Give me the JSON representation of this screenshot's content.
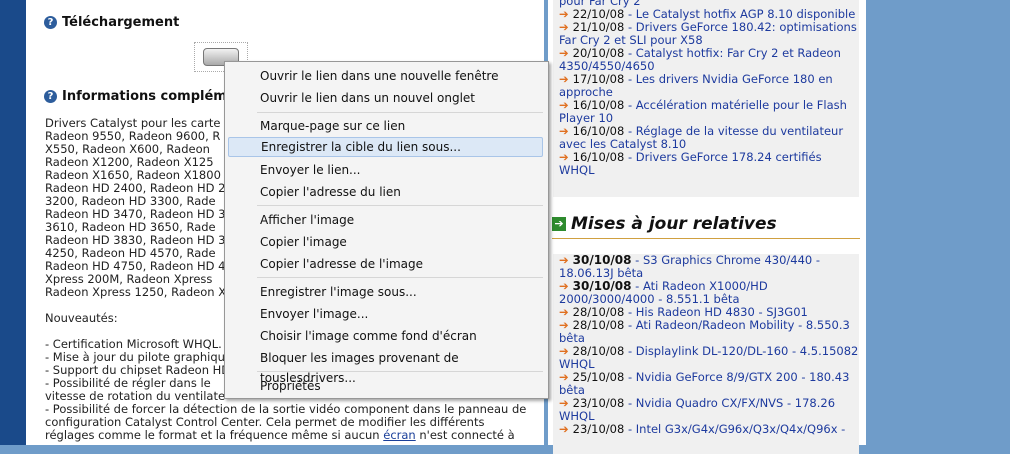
{
  "main": {
    "sections": [
      {
        "title": "Téléchargement"
      },
      {
        "title": "Informations compléme"
      }
    ],
    "text_lines": [
      "Drivers Catalyst pour les carte",
      "Radeon 9550, Radeon 9600, R",
      "X550, Radeon X600, Radeon",
      "Radeon X1200, Radeon X125",
      "Radeon X1650, Radeon X1800",
      "Radeon HD 2400, Radeon HD 2",
      "3200, Radeon HD 3300, Rade",
      "Radeon HD 3470, Radeon HD 3",
      "3610, Radeon HD 3650, Rade",
      "Radeon HD 3830, Radeon HD 3",
      "4250, Radeon HD 4570, Rade",
      "Radeon HD 4750, Radeon HD 4",
      "Xpress 200M, Radeon Xpress",
      "Radeon Xpress 1250, Radeon X",
      "",
      "Nouveautés:",
      "",
      "- Certification Microsoft WHQL.",
      "- Mise à jour du pilote graphiqu",
      "- Support du chipset Radeon HD",
      "- Possibilité de régler dans le",
      "vitesse de rotation du ventilate",
      "- Possibilité de forcer la détection de la sortie vidéo component dans le panneau de",
      "configuration Catalyst Control Center. Cela permet de modifier les différents"
    ],
    "last_line": {
      "before": "réglages comme le format et la fréquence même si aucun ",
      "link": "écran",
      "after": " n'est connecté à"
    }
  },
  "news_top": [
    {
      "date": "",
      "text": "pour Far Cry 2"
    },
    {
      "date": "22/10/08",
      "text": "Le Catalyst hotfix AGP 8.10 disponible"
    },
    {
      "date": "21/10/08",
      "text": "Drivers GeForce 180.42: optimisations Far Cry 2 et SLI pour X58"
    },
    {
      "date": "20/10/08",
      "text": "Catalyst hotfix: Far Cry 2 et Radeon 4350/4550/4650"
    },
    {
      "date": "17/10/08",
      "text": "Les drivers Nvidia GeForce 180 en approche"
    },
    {
      "date": "16/10/08",
      "text": "Accélération matérielle pour le Flash Player 10"
    },
    {
      "date": "16/10/08",
      "text": "Réglage de la vitesse du ventilateur avec les Catalyst 8.10"
    },
    {
      "date": "16/10/08",
      "text": "Drivers GeForce 178.24 certifiés WHQL"
    }
  ],
  "mises": {
    "title": "Mises à jour relatives",
    "items": [
      {
        "date": "30/10/08",
        "bold": true,
        "text": "S3 Graphics Chrome 430/440 - 18.06.13J bêta"
      },
      {
        "date": "30/10/08",
        "bold": true,
        "text": "Ati Radeon X1000/HD 2000/3000/4000 - 8.551.1 bêta"
      },
      {
        "date": "28/10/08",
        "bold": false,
        "text": "His Radeon HD 4830 - SJ3G01"
      },
      {
        "date": "28/10/08",
        "bold": false,
        "text": "Ati Radeon/Radeon Mobility - 8.550.3 bêta"
      },
      {
        "date": "28/10/08",
        "bold": false,
        "text": "Displaylink DL-120/DL-160 - 4.5.15082 WHQL"
      },
      {
        "date": "25/10/08",
        "bold": false,
        "text": "Nvidia GeForce 8/9/GTX 200 - 180.43 bêta"
      },
      {
        "date": "23/10/08",
        "bold": false,
        "text": "Nvidia Quadro CX/FX/NVS - 178.26 WHQL"
      },
      {
        "date": "23/10/08",
        "bold": false,
        "text": "Intel G3x/G4x/G96x/Q3x/Q4x/Q96x -"
      }
    ]
  },
  "context_menu": {
    "items": [
      {
        "label": "Ouvrir le lien dans une nouvelle fenêtre",
        "name": "ctx-open-new-window"
      },
      {
        "label": "Ouvrir le lien dans un nouvel onglet",
        "name": "ctx-open-new-tab"
      },
      {
        "label": "Marque-page sur ce lien",
        "name": "ctx-bookmark-link"
      },
      {
        "label": "Enregistrer la cible du lien sous...",
        "name": "ctx-save-link-target",
        "highlighted": true
      },
      {
        "label": "Envoyer le lien...",
        "name": "ctx-send-link"
      },
      {
        "label": "Copier l'adresse du lien",
        "name": "ctx-copy-link-address"
      },
      {
        "label": "Afficher l'image",
        "name": "ctx-view-image"
      },
      {
        "label": "Copier l'image",
        "name": "ctx-copy-image"
      },
      {
        "label": "Copier l'adresse de l'image",
        "name": "ctx-copy-image-address"
      },
      {
        "label": "Enregistrer l'image sous...",
        "name": "ctx-save-image"
      },
      {
        "label": "Envoyer l'image...",
        "name": "ctx-send-image"
      },
      {
        "label": "Choisir l'image comme fond d'écran",
        "name": "ctx-set-wallpaper"
      },
      {
        "label": "Bloquer les images provenant de touslesdrivers...",
        "name": "ctx-block-images"
      },
      {
        "label": "Propriétés",
        "name": "ctx-properties"
      }
    ]
  }
}
